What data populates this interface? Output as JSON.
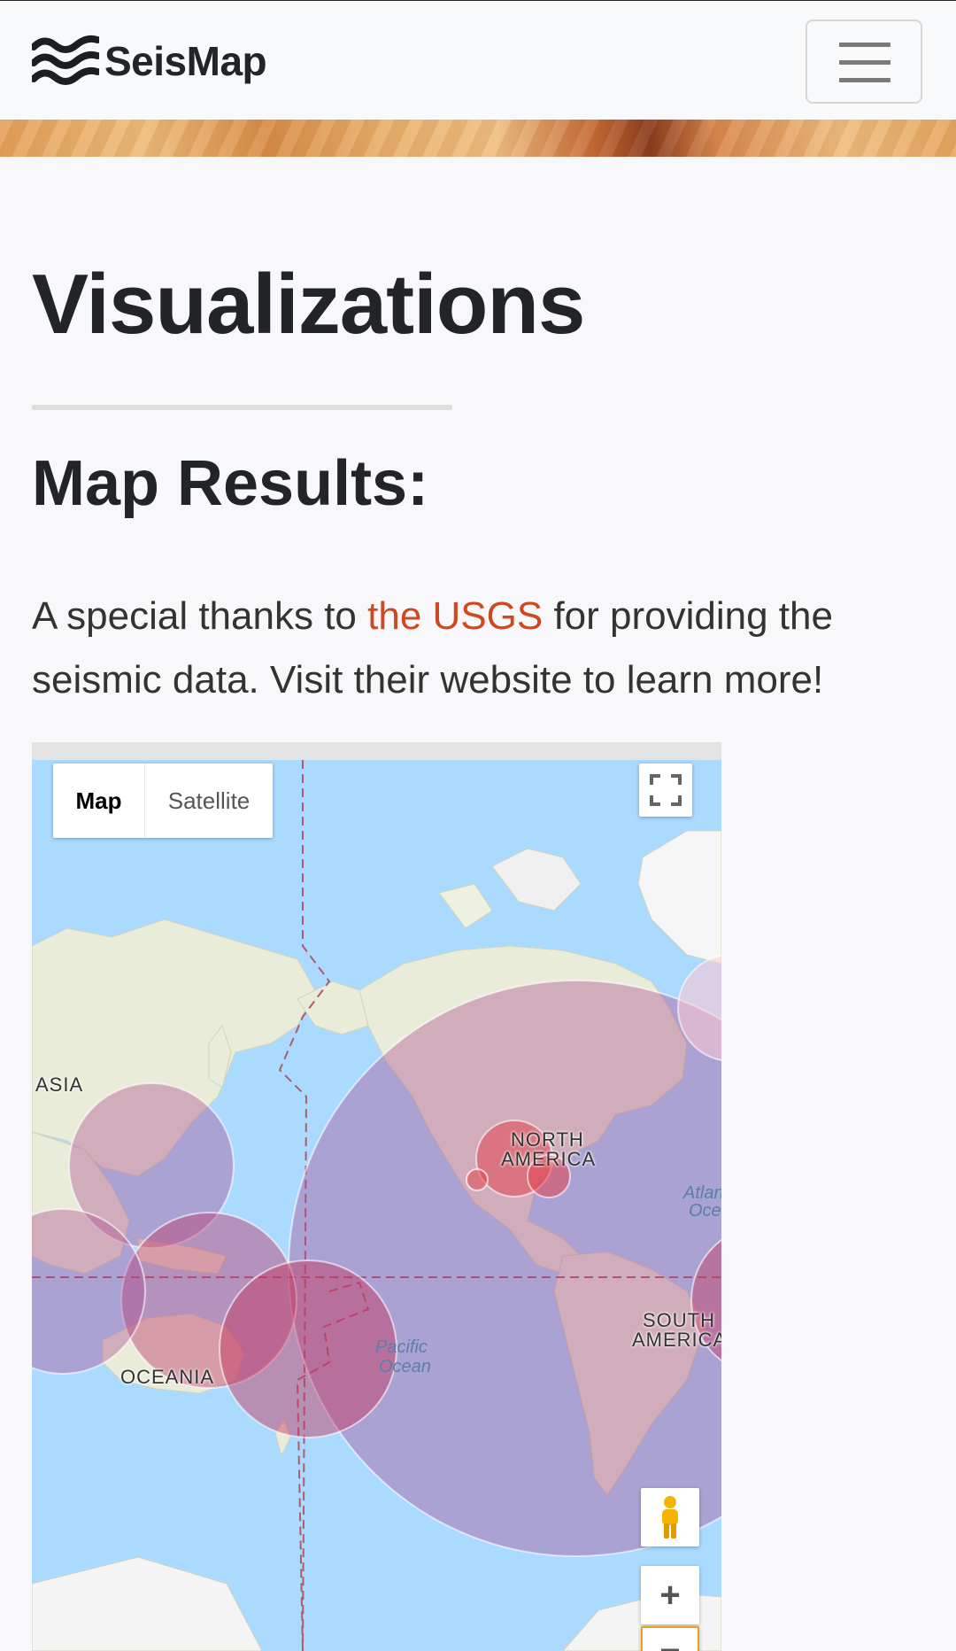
{
  "navbar": {
    "brand_name": "SeisMap",
    "brand_icon": "waves-icon",
    "menu_icon": "hamburger-icon"
  },
  "page": {
    "title": "Visualizations",
    "subtitle": "Map Results:",
    "lead_before": "A special thanks to ",
    "lead_link": "the USGS",
    "lead_after": " for providing the seismic data. Visit their website to learn more!"
  },
  "map": {
    "type_buttons": {
      "map": "Map",
      "satellite": "Satellite"
    },
    "fullscreen_icon": "fullscreen-icon",
    "pegman_icon": "pegman-icon",
    "zoom_in": "+",
    "zoom_out": "−",
    "labels": {
      "asia": "ASIA",
      "north_america_1": "NORTH",
      "north_america_2": "AMERICA",
      "south_america_1": "SOUTH",
      "south_america_2": "AMERICA",
      "oceania": "OCEANIA",
      "pacific_1": "Pacific",
      "pacific_2": "Ocean",
      "atlantic_1": "Atlan",
      "atlantic_2": "Oce"
    },
    "colors": {
      "water": "#aadaff",
      "land": "#e8ecd6",
      "circle_fill": "#c0392b",
      "accent_link": "#d0481f"
    }
  }
}
